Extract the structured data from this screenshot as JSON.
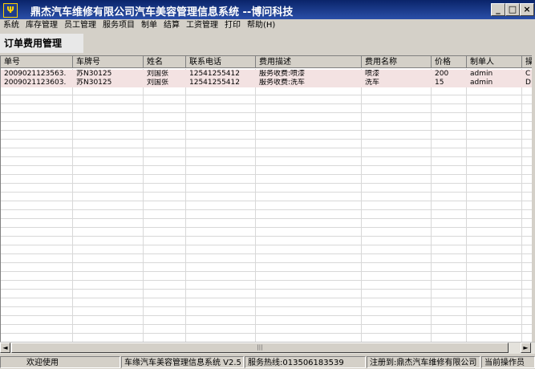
{
  "window": {
    "app_icon_glyph": "Ψ",
    "title": "鼎杰汽车维修有限公司汽车美容管理信息系统  --博问科技",
    "minimize_glyph": "_",
    "maximize_glyph": "□",
    "close_glyph": "×"
  },
  "menu": [
    "系统",
    "库存管理",
    "员工管理",
    "服务项目",
    "制单",
    "结算",
    "工资管理",
    "打印",
    "帮助(H)"
  ],
  "module_title": "订单费用管理",
  "grid": {
    "columns": [
      "单号",
      "车牌号",
      "姓名",
      "联系电话",
      "费用描述",
      "费用名称",
      "价格",
      "制单人",
      "操"
    ],
    "rows": [
      [
        "2009021123563.",
        "苏N30125",
        "刘国张",
        "12541255412",
        "服务收费:喷漆",
        "喷漆",
        "200",
        "admin",
        "C"
      ],
      [
        "2009021123603.",
        "苏N30125",
        "刘国张",
        "12541255412",
        "服务收费:洗车",
        "洗车",
        "15",
        "admin",
        "D"
      ]
    ]
  },
  "scrollbar": {
    "left_glyph": "◄",
    "right_glyph": "►",
    "grip": "|||"
  },
  "status": {
    "welcome": "欢迎使用",
    "version": "车缘汽车美容管理信息系统 V2.5",
    "hotline": "服务热线:013506183539",
    "registered": "注册到:鼎杰汽车维修有限公司",
    "operator": "当前操作员"
  }
}
